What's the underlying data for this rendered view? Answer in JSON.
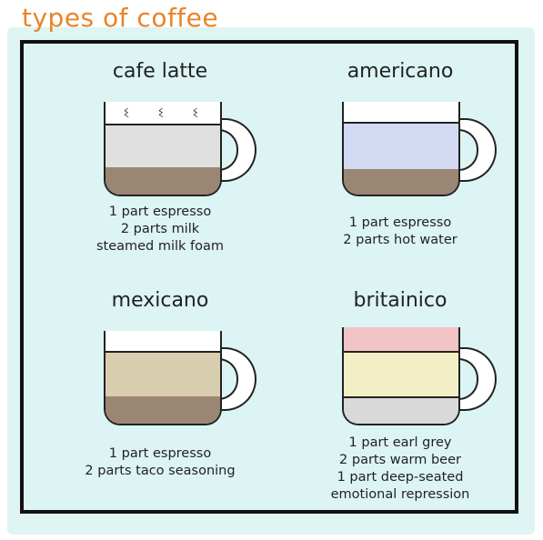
{
  "title": "types of coffee",
  "colors": {
    "title": "#e8852a",
    "panel_bg": "#dcf4f3",
    "espresso": "#9b8674",
    "milk": "#e0e0e0",
    "foam": "#ffffff",
    "hot_water": "#d3d9f2",
    "taco_seasoning": "#d9cdb0",
    "earl_grey": "#d9d9d9",
    "warm_beer": "#f2efc6",
    "emotional_repression": "#f2c4c5"
  },
  "drinks": [
    {
      "name": "cafe latte",
      "ingredients": [
        "1 part espresso",
        "2 parts milk",
        "steamed milk foam"
      ]
    },
    {
      "name": "americano",
      "ingredients": [
        "1 part espresso",
        "2 parts hot water"
      ]
    },
    {
      "name": "mexicano",
      "ingredients": [
        "1 part espresso",
        "2 parts taco seasoning"
      ]
    },
    {
      "name": "britainico",
      "ingredients": [
        "1 part earl grey",
        "2 parts warm beer",
        "1 part deep-seated",
        "emotional repression"
      ]
    }
  ]
}
